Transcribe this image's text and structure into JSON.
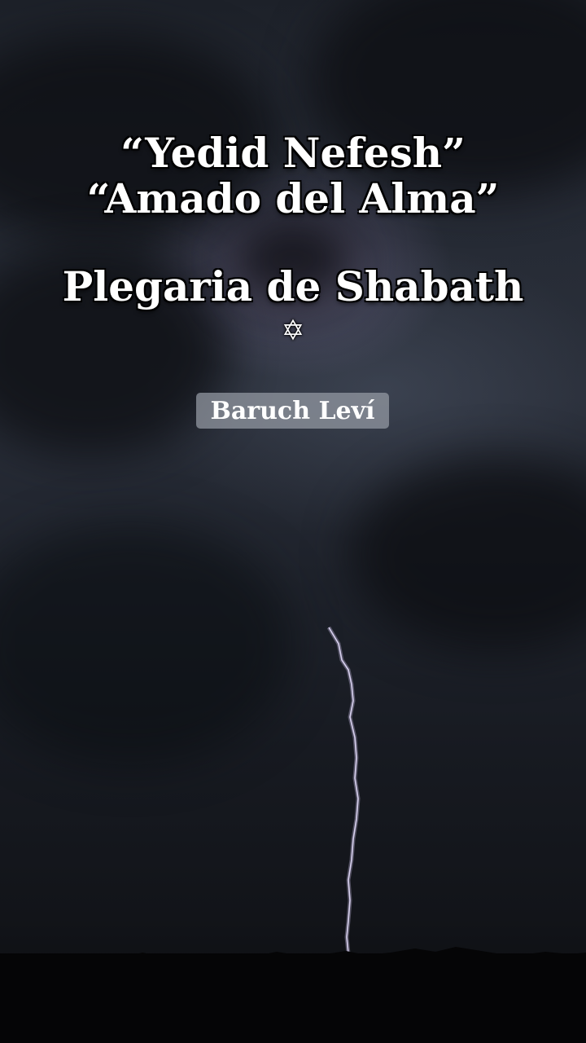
{
  "title": {
    "line1": "“Yedid Nefesh”",
    "line2": "“Amado del Alma”",
    "subtitle": "Plegaria de Shabath"
  },
  "icon": {
    "name": "star-of-david-icon",
    "glyph": "✡"
  },
  "author": {
    "name": "Baruch Leví"
  },
  "colors": {
    "text": "#ffffff",
    "badge": "#969ba5",
    "sky": "#262b35"
  }
}
